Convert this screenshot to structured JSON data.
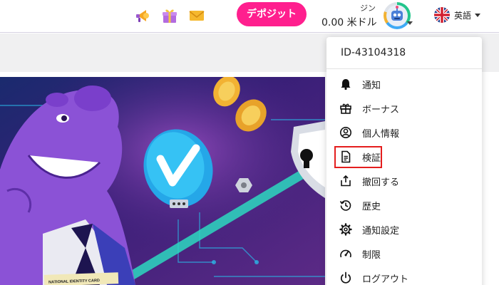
{
  "header": {
    "deposit_label": "デポジット",
    "balance_label": "ジン",
    "balance_value": "0.00 米ドル",
    "language_label": "英語",
    "icons": [
      "promo-icon",
      "gift-icon",
      "mail-icon"
    ]
  },
  "menu": {
    "user_id": "ID-43104318",
    "items": [
      {
        "label": "通知",
        "icon": "bell-icon"
      },
      {
        "label": "ボーナス",
        "icon": "gift-icon"
      },
      {
        "label": "個人情報",
        "icon": "user-circle-icon"
      },
      {
        "label": "検証",
        "icon": "document-icon"
      },
      {
        "label": "撤回する",
        "icon": "withdraw-icon"
      },
      {
        "label": "歴史",
        "icon": "history-icon"
      },
      {
        "label": "通知設定",
        "icon": "gear-icon"
      },
      {
        "label": "制限",
        "icon": "gauge-icon"
      },
      {
        "label": "ログアウト",
        "icon": "power-icon"
      }
    ],
    "highlighted_item": "検証"
  },
  "banner": {
    "card_text": "NATIONAL IDENTITY CARD"
  },
  "colors": {
    "deposit": "#ff1f8e",
    "highlight": "#e41e1e",
    "banner_bg": "#3a1f78"
  }
}
